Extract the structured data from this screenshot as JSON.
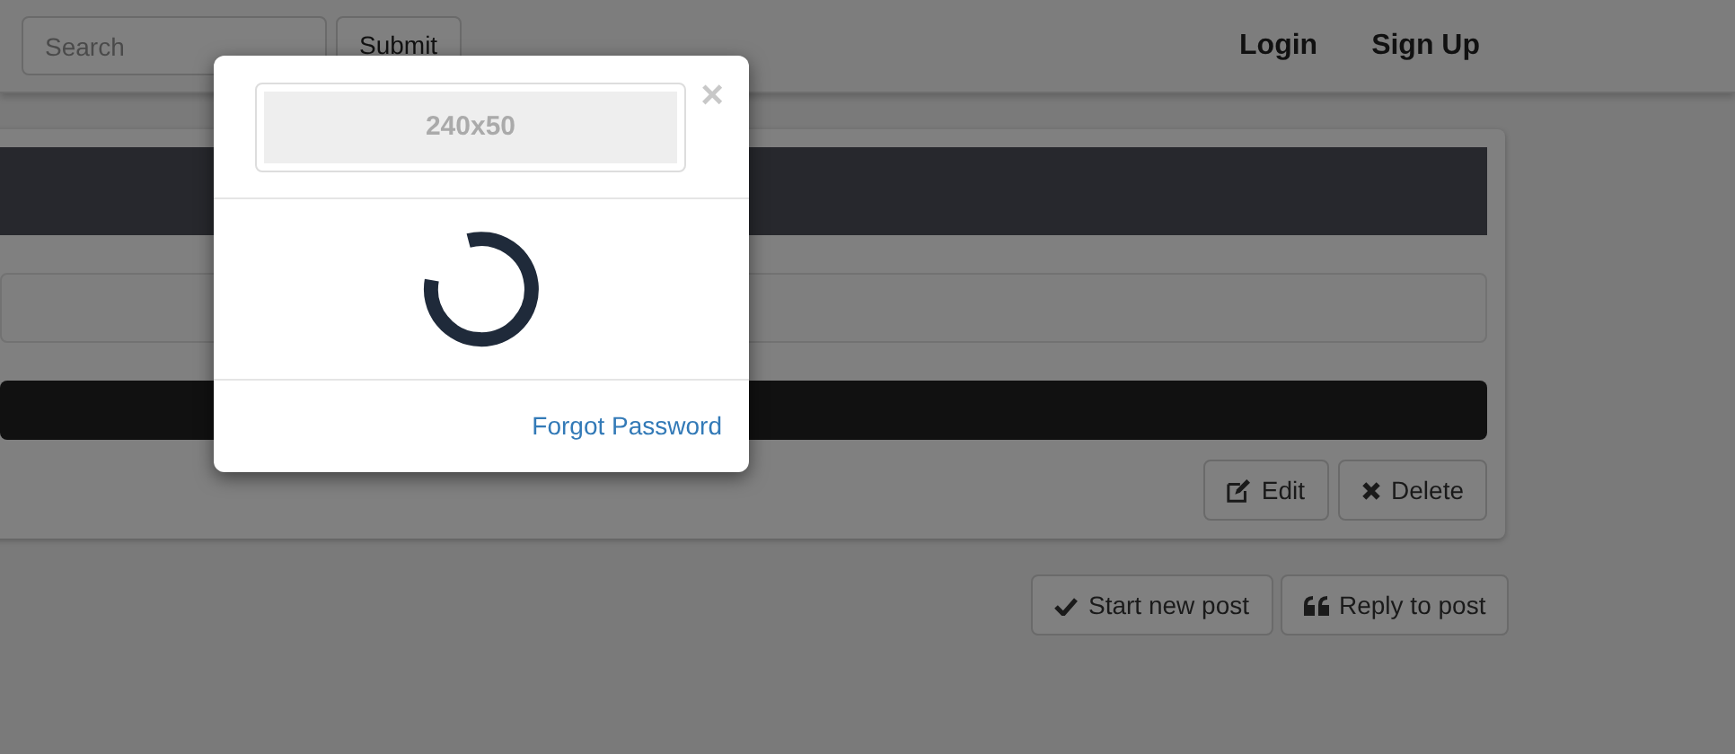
{
  "navbar": {
    "search": {
      "placeholder": "Search"
    },
    "submit": "Submit",
    "links": [
      "Login",
      "Sign Up"
    ]
  },
  "post": {
    "actions": [
      {
        "kind": "edit",
        "label": "Edit"
      },
      {
        "kind": "delete",
        "label": "Delete"
      }
    ]
  },
  "thread_actions": [
    {
      "kind": "check",
      "label": "Start new post"
    },
    {
      "kind": "quote",
      "label": "Reply to post"
    }
  ],
  "modal": {
    "logo_placeholder": "240x50",
    "close": "×",
    "loading": true,
    "link": "Forgot Password"
  }
}
